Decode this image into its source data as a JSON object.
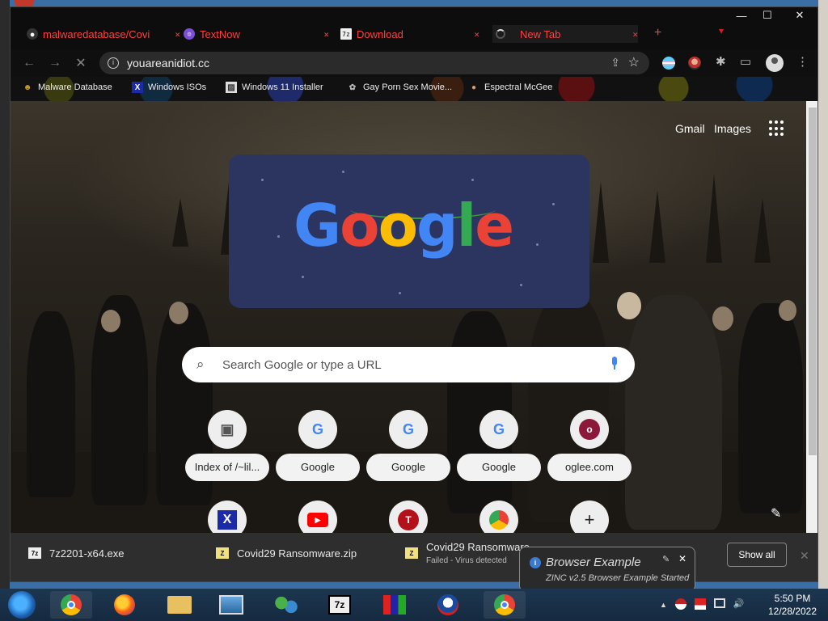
{
  "window": {
    "minimize": "—",
    "maximize": "☐",
    "close": "✕"
  },
  "tabs": [
    {
      "label": "malwaredatabase/Covi",
      "icon": "github-icon",
      "close": "✕"
    },
    {
      "label": "TextNow",
      "icon": "textnow-icon",
      "close": "✕"
    },
    {
      "label": "Download",
      "icon": "7zip-icon",
      "close": "✕"
    },
    {
      "label": "New Tab",
      "icon": "loading-spinner-icon",
      "close": "✕"
    }
  ],
  "new_tab": "+",
  "tab_search": "▾",
  "toolbar": {
    "back": "←",
    "forward": "→",
    "stop": "✕",
    "url": "youareanidiot.cc",
    "share": "⇪",
    "bookmark_star": "☆",
    "extensions": "✱",
    "side_panel": "▭",
    "menu": "⋮"
  },
  "bookmarks": [
    {
      "label": "Malware Database",
      "icon": "people-icon"
    },
    {
      "label": "Windows ISOs",
      "icon": "x-logo-icon"
    },
    {
      "label": "Windows 11 Installer",
      "icon": "image-icon"
    },
    {
      "label": "Gay Porn Sex Movie...",
      "icon": "paw-icon"
    },
    {
      "label": "Espectral McGee",
      "icon": "avatar-icon"
    }
  ],
  "ntp": {
    "gmail": "Gmail",
    "images": "Images",
    "doodle_letters": [
      "G",
      "o",
      "o",
      "g",
      "l",
      "e"
    ],
    "doodle_colors": [
      "#4285f4",
      "#ea4335",
      "#fbbc05",
      "#4285f4",
      "#34a853",
      "#ea4335"
    ],
    "search_placeholder": "Search Google or type a URL",
    "edit_icon": "✎",
    "shortcuts": [
      {
        "label": "Index of /~lil...",
        "glyph": "▣",
        "color": "#555"
      },
      {
        "label": "Google",
        "glyph": "G",
        "color": "#4285f4"
      },
      {
        "label": "Google",
        "glyph": "G",
        "color": "#4285f4"
      },
      {
        "label": "Google",
        "glyph": "G",
        "color": "#4285f4"
      },
      {
        "label": "oglee.com",
        "glyph": "o",
        "color": "#8b1a3a"
      }
    ],
    "shortcuts_row2": [
      {
        "glyph": "X",
        "color": "#1a2aa8"
      },
      {
        "glyph": "▶",
        "color": "#ff0000"
      },
      {
        "glyph": "T",
        "color": "#b3121a"
      },
      {
        "glyph": "◕",
        "color": "#ea4335"
      },
      {
        "glyph": "+",
        "color": "#222"
      }
    ]
  },
  "downloads": [
    {
      "name": "7z2201-x64.exe",
      "icon": "7z",
      "status": ""
    },
    {
      "name": "Covid29 Ransomware.zip",
      "icon": "Z",
      "status": ""
    },
    {
      "name": "Covid29 Ransomware...",
      "icon": "Z",
      "status": "Failed - Virus detected"
    }
  ],
  "show_all": "Show all",
  "download_close": "✕",
  "notification": {
    "title": "Browser Example",
    "text": "ZINC v2.5 Browser Example Started",
    "info_glyph": "i",
    "pin": "✎",
    "close": "✕"
  },
  "taskbar": {
    "apps": [
      "chrome",
      "firefox",
      "file-explorer",
      "photos",
      "network",
      "7zip",
      "installer",
      "obama",
      "chrome"
    ],
    "tray": {
      "chevron": "▲",
      "volume": "🔊"
    },
    "time": "5:50 PM",
    "date": "12/28/2022"
  }
}
